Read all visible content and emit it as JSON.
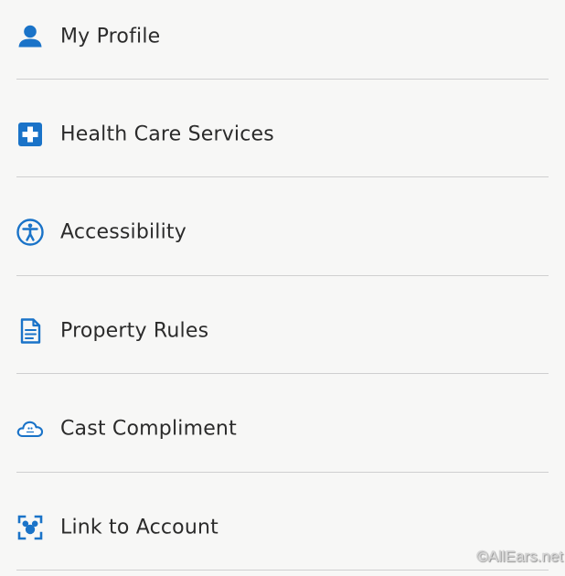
{
  "colors": {
    "background": "#f7f7f6",
    "icon_accent": "#1a73c8",
    "text": "#2b2b2b",
    "divider": "#cfcfd0"
  },
  "menu": {
    "items": [
      {
        "label": "My Profile",
        "icon": "person-icon"
      },
      {
        "label": "Health Care Services",
        "icon": "medical-cross-icon"
      },
      {
        "label": "Accessibility",
        "icon": "accessibility-icon"
      },
      {
        "label": "Property Rules",
        "icon": "document-icon"
      },
      {
        "label": "Cast Compliment",
        "icon": "cast-cloud-icon"
      },
      {
        "label": "Link to Account",
        "icon": "scan-mickey-icon"
      }
    ]
  },
  "watermark": "©AllEars.net"
}
